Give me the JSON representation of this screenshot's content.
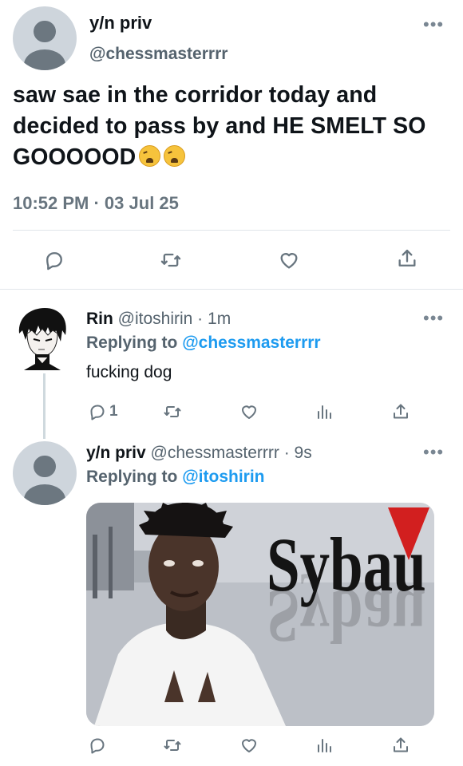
{
  "main_tweet": {
    "author_name": "y/n priv",
    "author_handle": "@chessmasterrrr",
    "text": "saw sae in the corridor today and decided to pass by and HE SMELT SO GOOOOOD",
    "emojis": [
      "weary-face-emoji",
      "weary-face-emoji"
    ],
    "timestamp": "10:52 PM · 03 Jul 25",
    "actions": [
      "reply-icon",
      "retweet-icon",
      "like-icon",
      "share-icon"
    ]
  },
  "reply_1": {
    "author_name": "Rin",
    "author_handle": "@itoshirin · 1m",
    "replying_label": "Replying to",
    "replying_to": "@chessmasterrrr",
    "text": "fucking dog",
    "reply_count": "1",
    "actions": [
      "reply-icon",
      "retweet-icon",
      "like-icon",
      "analytics-icon",
      "share-icon"
    ]
  },
  "reply_2": {
    "author_name": "y/n priv",
    "author_handle": "@chessmasterrrr · 9s",
    "replying_label": "Replying to",
    "replying_to": "@itoshirin",
    "media_text": "Sybau",
    "actions": [
      "reply-icon",
      "retweet-icon",
      "like-icon",
      "analytics-icon",
      "share-icon"
    ]
  },
  "colors": {
    "link": "#1d9bf0",
    "muted": "#68757f",
    "text": "#0f1419",
    "meme_red": "#d21f1f"
  }
}
